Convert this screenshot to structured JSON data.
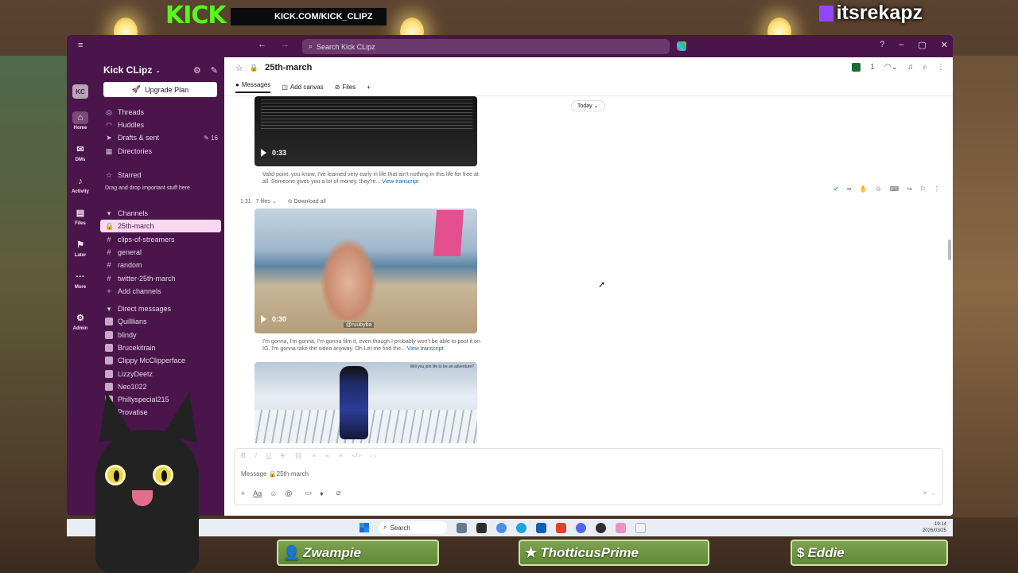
{
  "overlay": {
    "kick_logo": "KICK",
    "kick_url": "KICK.COM/KICK_CLIPZ",
    "twitch_name": "itsrekapz",
    "plates": [
      {
        "icon": "person-icon",
        "name": "Zwampie"
      },
      {
        "icon": "star-icon",
        "name": "ThotticusPrime"
      },
      {
        "icon": "dollar-icon",
        "name": "Eddie"
      }
    ]
  },
  "titlebar": {
    "search_placeholder": "Search Kick CLipz"
  },
  "rail": {
    "avatar": "KC",
    "items": [
      {
        "label": "Home",
        "icon": "home-icon"
      },
      {
        "label": "DMs",
        "icon": "dm-icon"
      },
      {
        "label": "Activity",
        "icon": "bell-icon"
      },
      {
        "label": "Files",
        "icon": "files-icon"
      },
      {
        "label": "Later",
        "icon": "bookmark-icon"
      },
      {
        "label": "More",
        "icon": "more-icon"
      },
      {
        "label": "Admin",
        "icon": "gear-icon"
      }
    ]
  },
  "sidebar": {
    "workspace": "Kick CLipz",
    "upgrade_label": "Upgrade Plan",
    "nav": [
      {
        "label": "Threads",
        "badge": ""
      },
      {
        "label": "Huddles",
        "badge": ""
      },
      {
        "label": "Drafts & sent",
        "badge": "16"
      },
      {
        "label": "Directories",
        "badge": ""
      }
    ],
    "starred_label": "Starred",
    "starred_hint": "Drag and drop important stuff here",
    "channels_label": "Channels",
    "channels": [
      "25th-march",
      "clips-of-streamers",
      "general",
      "random",
      "twitter-25th-march"
    ],
    "add_channels": "Add channels",
    "dm_label": "Direct messages",
    "dms": [
      "Quilllians",
      "blindy",
      "Brucekitrain",
      "Clippy McClipperface",
      "LizzyDeetz",
      "Neo1022",
      "Phillyspecial215",
      "Provatise"
    ]
  },
  "channel": {
    "name": "25th-march",
    "member_count": "1",
    "tabs": [
      "Messages",
      "Add canvas",
      "Files"
    ]
  },
  "feed": {
    "today": "Today",
    "video1_duration": "0:33",
    "transcript1": "Valid point, you know, I've learned very early in life that ain't nothing in this life for free at all. Someone gives you a lot of money, they're...",
    "view_transcript": "View transcript",
    "msg_time": "1:31",
    "files_count": "7 files",
    "download_all": "Download all",
    "video2_duration": "0:30",
    "video2_tag": "@ruubyba",
    "transcript2": "I'm gonna, I'm gonna, I'm gonna film it, even though I probably won't be able to post it on IG. I'm gonna take the video anyway. Oh Let me find the...",
    "video3_caption": "Will you join life to be an adventure?"
  },
  "composer": {
    "placeholder": "Message 🔒25th-march"
  },
  "taskbar": {
    "search": "Search",
    "time": "19:14",
    "date": "2026/03/25"
  }
}
